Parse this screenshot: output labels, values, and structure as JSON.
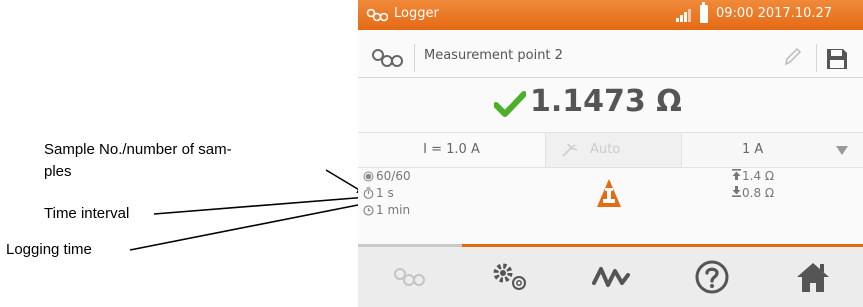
{
  "annotations": {
    "samples": "Sample No./number of sam-ples",
    "samples_line1": "Sample No./number of sam-",
    "samples_line2": "ples",
    "interval": "Time interval",
    "logging_time": "Logging time"
  },
  "statusbar": {
    "title": "Logger",
    "clock": "09:00 2017.10.27",
    "accent_color": "#e8711c"
  },
  "namebar": {
    "name": "Measurement point 2"
  },
  "result": {
    "value": "1.1473 Ω",
    "status_icon": "check-icon",
    "status_color": "#4caf2a"
  },
  "params": {
    "current": "I = 1.0 A",
    "mode": "Auto",
    "range": "1 A"
  },
  "info": {
    "samples": "60/60",
    "interval": "1 s",
    "logging_time": "1 min",
    "upper_limit": "1.4 Ω",
    "lower_limit": "0.8 Ω"
  },
  "navbar": {
    "icons": [
      "logger-icon",
      "settings-icon",
      "graph-icon",
      "help-icon",
      "home-icon"
    ]
  }
}
